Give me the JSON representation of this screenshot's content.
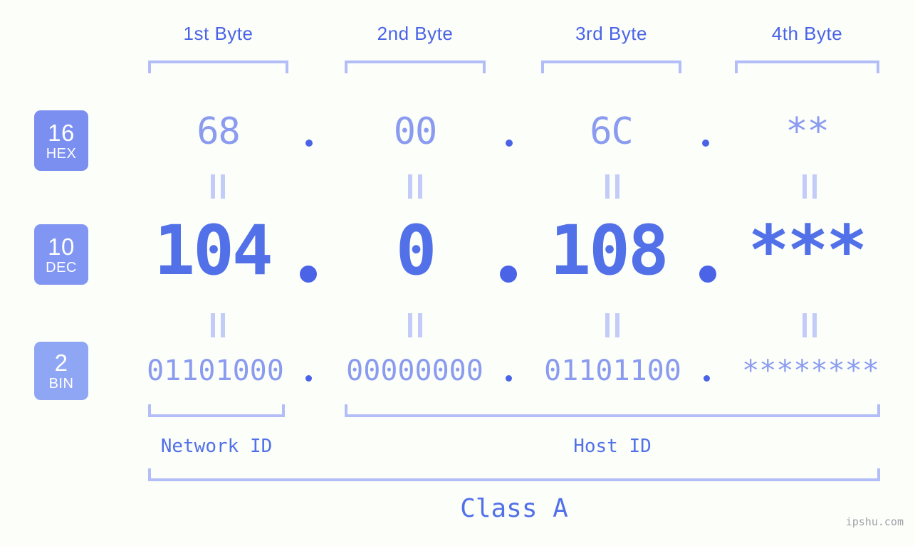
{
  "meta": {
    "background_color": "#fcfefa",
    "accent_color": "#5271e8",
    "light_accent_color": "#8a9bf0",
    "bracket_color": "#b3bdf7",
    "watermark": "ipshu.com"
  },
  "byte_headers": [
    {
      "label": "1st Byte"
    },
    {
      "label": "2nd Byte"
    },
    {
      "label": "3rd Byte"
    },
    {
      "label": "4th Byte"
    }
  ],
  "rows": [
    {
      "id": "hex",
      "badge": {
        "num": "16",
        "label": "HEX",
        "color": "#7a8ff0"
      },
      "values": [
        "68",
        "00",
        "6C",
        "**"
      ],
      "separator": "."
    },
    {
      "id": "dec",
      "badge": {
        "num": "10",
        "label": "DEC",
        "color": "#8195f2"
      },
      "values": [
        "104",
        "0",
        "108",
        "***"
      ],
      "separator": "."
    },
    {
      "id": "bin",
      "badge": {
        "num": "2",
        "label": "BIN",
        "color": "#8fa6f4"
      },
      "values": [
        "01101000",
        "00000000",
        "01101100",
        "********"
      ],
      "separator": "."
    }
  ],
  "equals_marks": {
    "symbol": "||",
    "count_per_gap": 4,
    "gaps": 2
  },
  "segments": [
    {
      "name": "network-id",
      "label": "Network ID"
    },
    {
      "name": "host-id",
      "label": "Host ID"
    }
  ],
  "class": {
    "label": "Class A"
  }
}
